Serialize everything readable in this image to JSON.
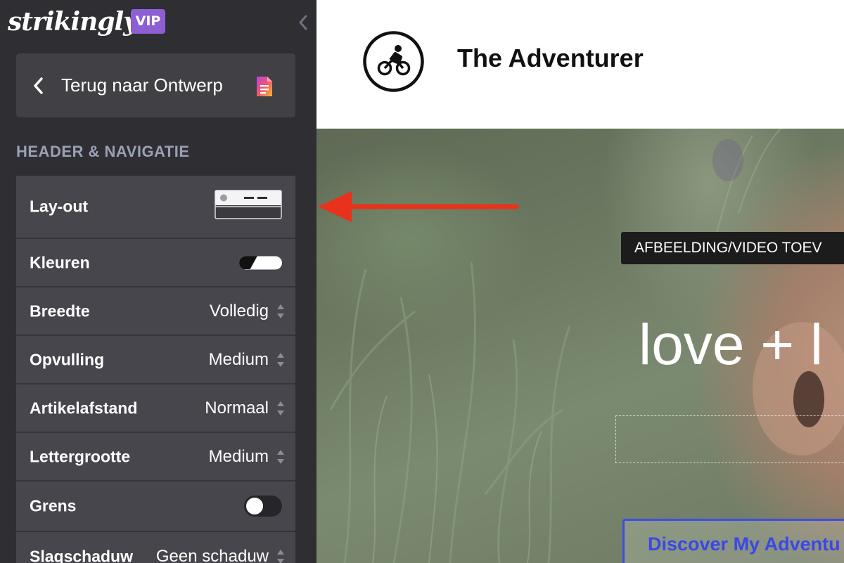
{
  "sidebar": {
    "logo_text": "strikingly",
    "vip_badge": "VIP",
    "back_label": "Terug naar Ontwerp",
    "section_title": "HEADER & NAVIGATIE",
    "settings": [
      {
        "label": "Lay-out",
        "control": "layout-thumbnail"
      },
      {
        "label": "Kleuren",
        "control": "color-toggle"
      },
      {
        "label": "Breedte",
        "value": "Volledig"
      },
      {
        "label": "Opvulling",
        "value": "Medium"
      },
      {
        "label": "Artikelafstand",
        "value": "Normaal"
      },
      {
        "label": "Lettergrootte",
        "value": "Medium"
      },
      {
        "label": "Grens",
        "control": "switch",
        "enabled": false
      },
      {
        "label": "Slagschaduw",
        "value": "Geen schaduw"
      }
    ]
  },
  "preview": {
    "site_title": "The Adventurer",
    "media_badge": "AFBEELDING/VIDEO TOEV",
    "hero_heading": "love + l",
    "cta_label": "Discover My Adventu"
  },
  "colors": {
    "sidebar_bg": "#2f2f33",
    "row_bg": "#46464c",
    "vip": "#8e5fd3",
    "section_title": "#9aa0b4",
    "cta": "#3e4ee0",
    "arrow": "#e8321c"
  },
  "icons": {
    "collapse": "chevron-left-icon",
    "back": "chevron-left-icon",
    "document": "document-icon",
    "site_logo": "cyclist-icon",
    "stepper": "up-down-stepper-icon"
  }
}
